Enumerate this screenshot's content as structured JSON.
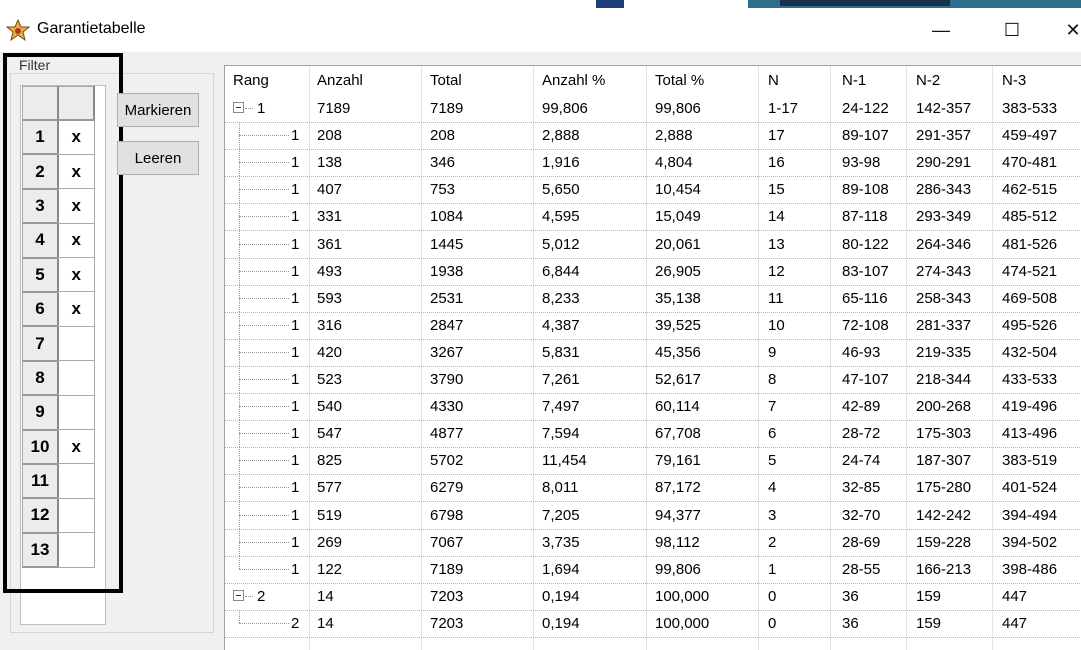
{
  "window": {
    "title": "Garantietabelle",
    "minimize": "—",
    "maximize": "☐",
    "close": "✕"
  },
  "filter": {
    "label": "Filter",
    "rows": [
      {
        "num": "1",
        "mark": "x"
      },
      {
        "num": "2",
        "mark": "x"
      },
      {
        "num": "3",
        "mark": "x"
      },
      {
        "num": "4",
        "mark": "x"
      },
      {
        "num": "5",
        "mark": "x"
      },
      {
        "num": "6",
        "mark": "x"
      },
      {
        "num": "7",
        "mark": ""
      },
      {
        "num": "8",
        "mark": ""
      },
      {
        "num": "9",
        "mark": ""
      },
      {
        "num": "10",
        "mark": "x"
      },
      {
        "num": "11",
        "mark": ""
      },
      {
        "num": "12",
        "mark": ""
      },
      {
        "num": "13",
        "mark": ""
      }
    ]
  },
  "buttons": {
    "mark": "Markieren",
    "clear": "Leeren"
  },
  "table": {
    "columns": [
      "Rang",
      "Anzahl",
      "Total",
      "Anzahl %",
      "Total %",
      "N",
      "N-1",
      "N-2",
      "N-3"
    ],
    "rows": [
      {
        "level": 0,
        "expand": true,
        "rang": "1",
        "cells": [
          "7189",
          "7189",
          "99,806",
          "99,806",
          "1-17",
          "24-122",
          "142-357",
          "383-533"
        ]
      },
      {
        "level": 1,
        "rang": "1",
        "cells": [
          "208",
          "208",
          "2,888",
          "2,888",
          "17",
          "89-107",
          "291-357",
          "459-497"
        ]
      },
      {
        "level": 1,
        "rang": "1",
        "cells": [
          "138",
          "346",
          "1,916",
          "4,804",
          "16",
          "93-98",
          "290-291",
          "470-481"
        ]
      },
      {
        "level": 1,
        "rang": "1",
        "cells": [
          "407",
          "753",
          "5,650",
          "10,454",
          "15",
          "89-108",
          "286-343",
          "462-515"
        ]
      },
      {
        "level": 1,
        "rang": "1",
        "cells": [
          "331",
          "1084",
          "4,595",
          "15,049",
          "14",
          "87-118",
          "293-349",
          "485-512"
        ]
      },
      {
        "level": 1,
        "rang": "1",
        "cells": [
          "361",
          "1445",
          "5,012",
          "20,061",
          "13",
          "80-122",
          "264-346",
          "481-526"
        ]
      },
      {
        "level": 1,
        "rang": "1",
        "cells": [
          "493",
          "1938",
          "6,844",
          "26,905",
          "12",
          "83-107",
          "274-343",
          "474-521"
        ]
      },
      {
        "level": 1,
        "rang": "1",
        "cells": [
          "593",
          "2531",
          "8,233",
          "35,138",
          "11",
          "65-116",
          "258-343",
          "469-508"
        ]
      },
      {
        "level": 1,
        "rang": "1",
        "cells": [
          "316",
          "2847",
          "4,387",
          "39,525",
          "10",
          "72-108",
          "281-337",
          "495-526"
        ]
      },
      {
        "level": 1,
        "rang": "1",
        "cells": [
          "420",
          "3267",
          "5,831",
          "45,356",
          "9",
          "46-93",
          "219-335",
          "432-504"
        ]
      },
      {
        "level": 1,
        "rang": "1",
        "cells": [
          "523",
          "3790",
          "7,261",
          "52,617",
          "8",
          "47-107",
          "218-344",
          "433-533"
        ]
      },
      {
        "level": 1,
        "rang": "1",
        "cells": [
          "540",
          "4330",
          "7,497",
          "60,114",
          "7",
          "42-89",
          "200-268",
          "419-496"
        ]
      },
      {
        "level": 1,
        "rang": "1",
        "cells": [
          "547",
          "4877",
          "7,594",
          "67,708",
          "6",
          "28-72",
          "175-303",
          "413-496"
        ]
      },
      {
        "level": 1,
        "rang": "1",
        "cells": [
          "825",
          "5702",
          "11,454",
          "79,161",
          "5",
          "24-74",
          "187-307",
          "383-519"
        ]
      },
      {
        "level": 1,
        "rang": "1",
        "cells": [
          "577",
          "6279",
          "8,011",
          "87,172",
          "4",
          "32-85",
          "175-280",
          "401-524"
        ]
      },
      {
        "level": 1,
        "rang": "1",
        "cells": [
          "519",
          "6798",
          "7,205",
          "94,377",
          "3",
          "32-70",
          "142-242",
          "394-494"
        ]
      },
      {
        "level": 1,
        "rang": "1",
        "cells": [
          "269",
          "7067",
          "3,735",
          "98,112",
          "2",
          "28-69",
          "159-228",
          "394-502"
        ]
      },
      {
        "level": 1,
        "rang": "1",
        "cells": [
          "122",
          "7189",
          "1,694",
          "99,806",
          "1",
          "28-55",
          "166-213",
          "398-486"
        ]
      },
      {
        "level": 0,
        "expand": true,
        "rang": "2",
        "cells": [
          "14",
          "7203",
          "0,194",
          "100,000",
          "0",
          "36",
          "159",
          "447"
        ]
      },
      {
        "level": 1,
        "rang": "2",
        "cells": [
          "14",
          "7203",
          "0,194",
          "100,000",
          "0",
          "36",
          "159",
          "447"
        ]
      }
    ]
  }
}
